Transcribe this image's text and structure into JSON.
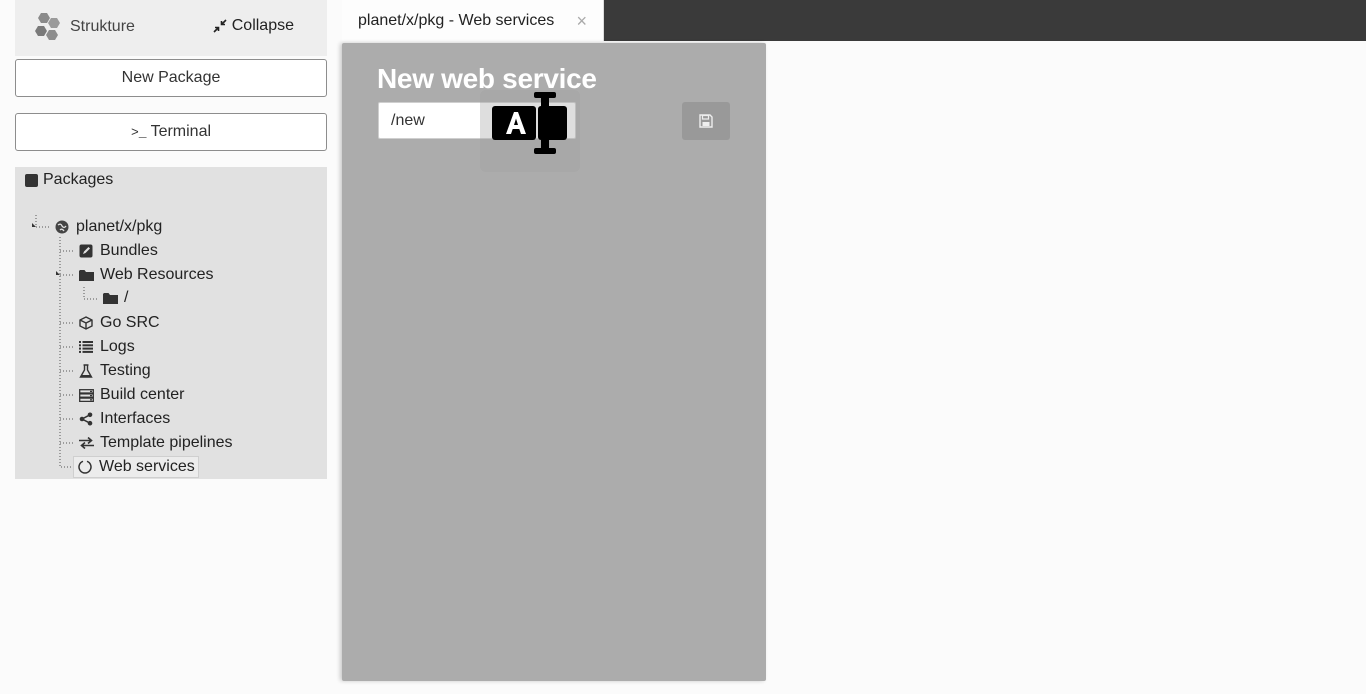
{
  "sidebar": {
    "brand": "Strukture",
    "collapse_label": "Collapse",
    "new_package_label": "New Package",
    "terminal_prompt": ">_",
    "terminal_label": "Terminal",
    "packages_title": "Packages",
    "tree": {
      "root": "planet/x/pkg",
      "bundles": "Bundles",
      "web_resources": "Web Resources",
      "web_root": "/",
      "go_src": "Go SRC",
      "logs": "Logs",
      "testing": "Testing",
      "build_center": "Build center",
      "interfaces": "Interfaces",
      "template_pipelines": "Template pipelines",
      "web_services": "Web services"
    }
  },
  "tabs": [
    {
      "label": "planet/x/pkg - Web services",
      "close": "×"
    }
  ],
  "panel": {
    "title": "New web service",
    "path_value": "/new"
  },
  "colors": {
    "tabbar": "#3a3a3a",
    "panel": "#acacac",
    "packages_bg": "#e1e1e1"
  },
  "icons": {
    "brand": "hexagon-cluster-icon",
    "collapse": "compress-arrows-icon",
    "save": "floppy-disk-icon",
    "cursor": "text-cursor-icon"
  }
}
